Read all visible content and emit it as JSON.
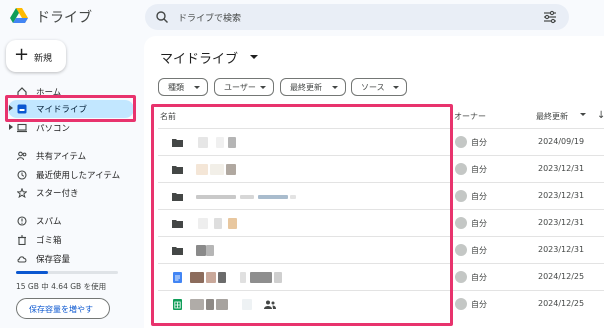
{
  "header": {
    "app_name": "ドライブ",
    "search_placeholder": "ドライブで検索"
  },
  "new_button": {
    "label": "新規"
  },
  "sidebar": {
    "items": [
      {
        "label": "ホーム",
        "icon": "home-icon"
      },
      {
        "label": "マイドライブ",
        "icon": "my-drive-icon",
        "active": true
      },
      {
        "label": "パソコン",
        "icon": "computer-icon"
      },
      {
        "label": "共有アイテム",
        "icon": "shared-icon"
      },
      {
        "label": "最近使用したアイテム",
        "icon": "clock-icon"
      },
      {
        "label": "スター付き",
        "icon": "star-icon"
      },
      {
        "label": "スパム",
        "icon": "spam-icon"
      },
      {
        "label": "ゴミ箱",
        "icon": "trash-icon"
      },
      {
        "label": "保存容量",
        "icon": "cloud-icon"
      }
    ],
    "storage": {
      "used_text": "15 GB 中 4.64 GB を使用",
      "used_fraction": 0.31,
      "button_label": "保存容量を増やす"
    }
  },
  "main": {
    "title": "マイドライブ",
    "filters": [
      "種類",
      "ユーザー",
      "最終更新",
      "ソース"
    ],
    "columns": {
      "name": "名前",
      "owner": "オーナー",
      "modified": "最終更新"
    },
    "rows": [
      {
        "type": "folder",
        "owner": "自分",
        "date": "2024/09/19"
      },
      {
        "type": "folder",
        "owner": "自分",
        "date": "2023/12/31"
      },
      {
        "type": "folder",
        "owner": "自分",
        "date": "2023/12/31"
      },
      {
        "type": "folder",
        "owner": "自分",
        "date": "2023/12/31"
      },
      {
        "type": "folder",
        "owner": "自分",
        "date": "2023/12/31"
      },
      {
        "type": "doc",
        "owner": "自分",
        "date": "2024/12/25"
      },
      {
        "type": "sheet",
        "owner": "自分",
        "date": "2024/12/25",
        "shared": true
      }
    ]
  },
  "colors": {
    "accent": "#0b57d0",
    "active_nav": "#c2e7ff",
    "highlight": "#e8336d"
  }
}
